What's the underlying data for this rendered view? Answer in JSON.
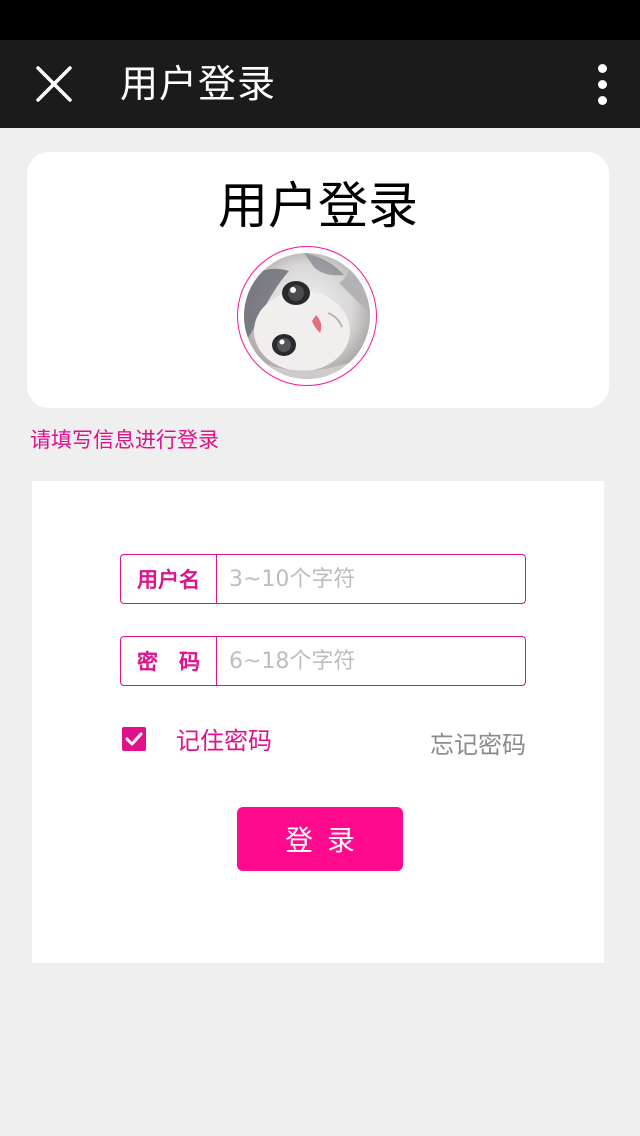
{
  "navbar": {
    "title": "用户登录",
    "close_icon": "close-icon",
    "more_icon": "more-vertical-icon",
    "background": "#1b1b1b"
  },
  "header_card": {
    "title": "用户登录",
    "avatar_icon": "cat-avatar"
  },
  "hint": "请填写信息进行登录",
  "form": {
    "username": {
      "label": "用户名",
      "value": "",
      "placeholder": "3~10个字符"
    },
    "password": {
      "label": "密　码",
      "value": "",
      "placeholder": "6~18个字符"
    },
    "remember": {
      "label": "记住密码",
      "checked": true
    },
    "forgot_label": "忘记密码",
    "login_label": "登录"
  },
  "colors": {
    "accent": "#e0118a",
    "button": "#ff0a8d",
    "page_background": "#efefef"
  }
}
